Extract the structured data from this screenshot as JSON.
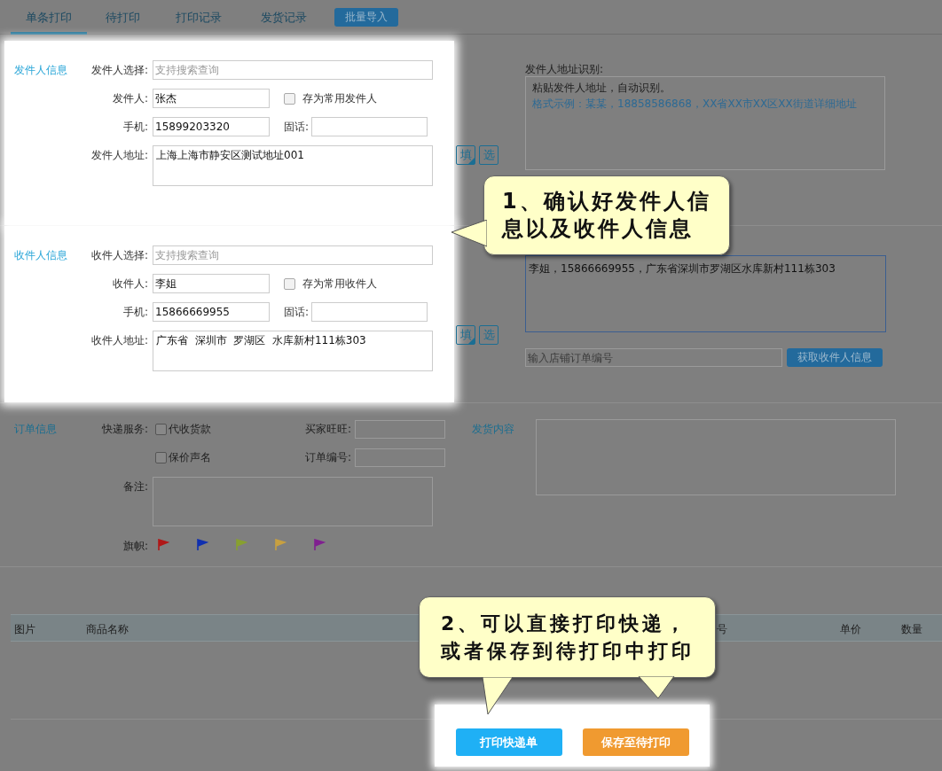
{
  "tabs": [
    {
      "label": "单条打印",
      "selected": true
    },
    {
      "label": "待打印",
      "selected": false
    },
    {
      "label": "打印记录",
      "selected": false
    },
    {
      "label": "发货记录",
      "selected": false
    }
  ],
  "batch_import_button": "批量导入",
  "sender": {
    "spotlight": true,
    "section_label": "发件人信息",
    "select_label": "发件人选择:",
    "select_placeholder": "支持搜索查询",
    "name_label": "发件人:",
    "name_value": "张杰",
    "save_checkbox": {
      "label": "存为常用发件人",
      "checked": false
    },
    "mobile_label": "手机:",
    "mobile_value": "15899203320",
    "phone_label": "固话:",
    "address_label": "发件人地址:",
    "address_value": "上海上海市静安区测试地址001",
    "fill_button": "填",
    "choose_button": "选",
    "recognize_label": "发件人地址识别:",
    "recognize_text": "粘贴发件人地址，自动识别。",
    "recognize_example": "格式示例：某某，18858586868，XX省XX市XX区XX街道详细地址"
  },
  "receiver": {
    "spotlight": true,
    "section_label": "收件人信息",
    "select_label": "收件人选择:",
    "select_placeholder": "支持搜索查询",
    "name_label": "收件人:",
    "name_value": "李姐",
    "save_checkbox": {
      "label": "存为常用收件人",
      "checked": false
    },
    "mobile_label": "手机:",
    "mobile_value": "15866669955",
    "phone_label": "固话:",
    "address_label": "收件人地址:",
    "address_value": "广东省  深圳市  罗湖区  水库新村111栋303",
    "fill_button": "填",
    "choose_button": "选",
    "recognize_value": "李姐，15866669955，广东省深圳市罗湖区水库新村111栋303",
    "shop_order_placeholder": "输入店铺订单编号",
    "fetch_button": "获取收件人信息"
  },
  "order": {
    "section_label": "订单信息",
    "service_label": "快递服务:",
    "services": [
      {
        "label": "代收货款",
        "checked": false
      },
      {
        "label": "保价声名",
        "checked": false
      }
    ],
    "buyer_label": "买家旺旺:",
    "order_no_label": "订单编号:",
    "remark_label": "备注:",
    "flag_label": "旗帜:",
    "flags": [
      {
        "color": "#b01818"
      },
      {
        "color": "#1030b0"
      },
      {
        "color": "#88a030"
      },
      {
        "color": "#c8a040"
      },
      {
        "color": "#802090"
      }
    ],
    "content_label": "发货内容"
  },
  "goods_table": {
    "columns": [
      "图片",
      "商品名称",
      "号",
      "单价",
      "数量"
    ]
  },
  "actions": {
    "spotlight": true,
    "buttons": [
      {
        "label": "打印快递单",
        "kind": "primary"
      },
      {
        "label": "保存至待打印",
        "kind": "secondary"
      }
    ]
  },
  "callouts": [
    {
      "text": "1、确认好发件人信息以及收件人信息",
      "kind": "left"
    },
    {
      "text": "2、可以直接打印快递，或者保存到待打印中打印",
      "kind": "down"
    }
  ]
}
